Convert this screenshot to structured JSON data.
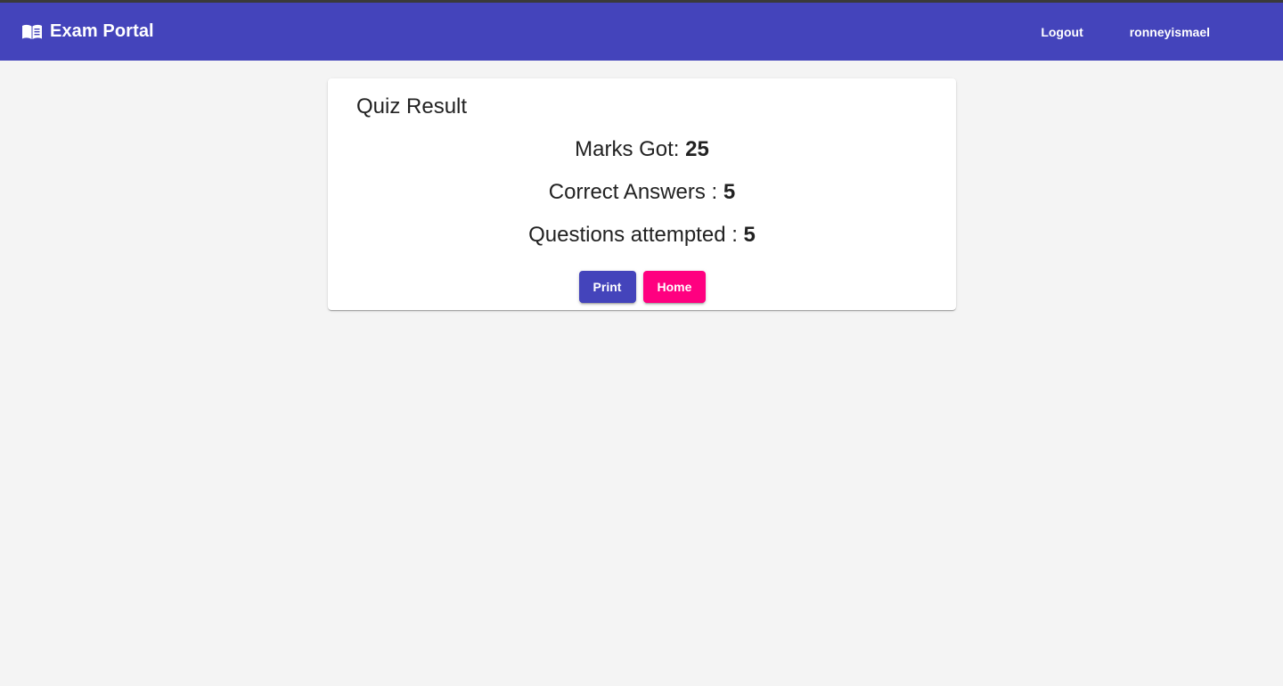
{
  "toolbar": {
    "icon": "menu-book-icon",
    "title": "Exam Portal",
    "logout_label": "Logout",
    "username": "ronneyismael",
    "background": "#4444bb"
  },
  "result": {
    "title": "Quiz Result",
    "marks_label": "Marks Got:",
    "marks_value": "25",
    "correct_label": "Correct Answers :",
    "correct_value": "5",
    "attempted_label": "Questions attempted :",
    "attempted_value": "5"
  },
  "actions": {
    "print_label": "Print",
    "home_label": "Home",
    "print_color": "#4444bb",
    "home_color": "#ff0080"
  }
}
